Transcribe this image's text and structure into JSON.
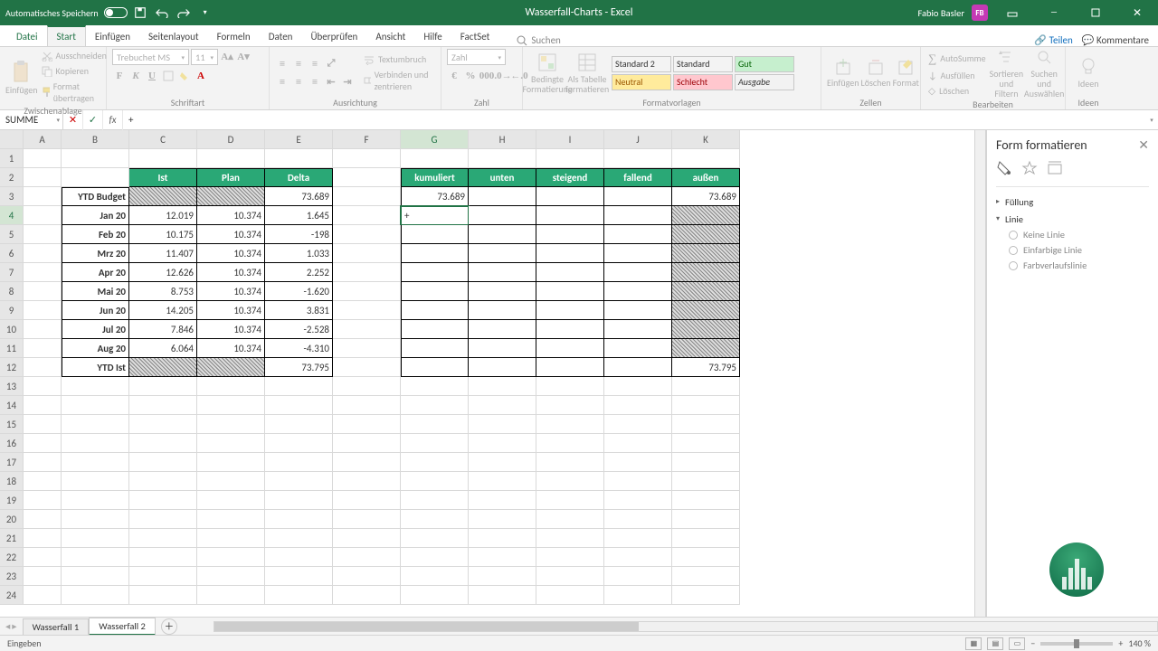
{
  "titlebar": {
    "autosave_label": "Automatisches Speichern",
    "doc_title": "Wasserfall-Charts  -  Excel",
    "user_name": "Fabio Basler",
    "user_initials": "FB"
  },
  "tabs": {
    "file": "Datei",
    "items": [
      "Start",
      "Einfügen",
      "Seitenlayout",
      "Formeln",
      "Daten",
      "Überprüfen",
      "Ansicht",
      "Hilfe",
      "FactSet"
    ],
    "active_index": 0,
    "search_placeholder": "Suchen",
    "share": "Teilen",
    "comments": "Kommentare"
  },
  "ribbon": {
    "clipboard": {
      "label": "Zwischenablage",
      "paste": "Einfügen",
      "cut": "Ausschneiden",
      "copy": "Kopieren",
      "format_painter": "Format übertragen"
    },
    "font": {
      "label": "Schriftart",
      "name": "Trebuchet MS",
      "size": "11"
    },
    "alignment": {
      "label": "Ausrichtung",
      "wrap": "Textumbruch",
      "merge": "Verbinden und zentrieren"
    },
    "number": {
      "label": "Zahl",
      "format": "Zahl"
    },
    "styles": {
      "label": "Formatvorlagen",
      "conditional": "Bedingte Formatierung",
      "as_table": "Als Tabelle formatieren",
      "cells": {
        "standard": "Standard",
        "standard2": "Standard 2",
        "gut": "Gut",
        "neutral": "Neutral",
        "schlecht": "Schlecht",
        "ausgabe": "Ausgabe"
      }
    },
    "cells": {
      "label": "Zellen",
      "insert": "Einfügen",
      "delete": "Löschen",
      "format": "Format"
    },
    "editing": {
      "label": "Bearbeiten",
      "autosum": "AutoSumme",
      "fill": "Ausfüllen",
      "clear": "Löschen",
      "sort": "Sortieren und Filtern",
      "find": "Suchen und Auswählen"
    },
    "ideas": {
      "label": "Ideen",
      "btn": "Ideen"
    }
  },
  "namebox": "SUMME",
  "formula": "+",
  "columns": [
    "A",
    "B",
    "C",
    "D",
    "E",
    "F",
    "G",
    "H",
    "I",
    "J",
    "K"
  ],
  "rows_visible": 24,
  "active_col_index": 6,
  "active_row": 4,
  "editing_cell_value": "+",
  "table1": {
    "headers": {
      "ist": "Ist",
      "plan": "Plan",
      "delta": "Delta"
    },
    "rows": [
      {
        "label": "YTD Budget",
        "ist": "",
        "plan": "",
        "delta": "73.689",
        "hatch_ist": true,
        "hatch_plan": true
      },
      {
        "label": "Jan 20",
        "ist": "12.019",
        "plan": "10.374",
        "delta": "1.645"
      },
      {
        "label": "Feb 20",
        "ist": "10.175",
        "plan": "10.374",
        "delta": "-198"
      },
      {
        "label": "Mrz 20",
        "ist": "11.407",
        "plan": "10.374",
        "delta": "1.033"
      },
      {
        "label": "Apr 20",
        "ist": "12.626",
        "plan": "10.374",
        "delta": "2.252"
      },
      {
        "label": "Mai 20",
        "ist": "8.753",
        "plan": "10.374",
        "delta": "-1.620"
      },
      {
        "label": "Jun 20",
        "ist": "14.205",
        "plan": "10.374",
        "delta": "3.831"
      },
      {
        "label": "Jul 20",
        "ist": "7.846",
        "plan": "10.374",
        "delta": "-2.528"
      },
      {
        "label": "Aug 20",
        "ist": "6.064",
        "plan": "10.374",
        "delta": "-4.310"
      },
      {
        "label": "YTD Ist",
        "ist": "",
        "plan": "",
        "delta": "73.795",
        "hatch_ist": true,
        "hatch_plan": true
      }
    ]
  },
  "table2": {
    "headers": {
      "kum": "kumuliert",
      "unten": "unten",
      "steig": "steigend",
      "fall": "fallend",
      "aussen": "außen"
    },
    "rows": [
      {
        "kum": "73.689",
        "aussen": "73.689"
      },
      {
        "kum": "",
        "aussen": "",
        "hatch_aussen": true
      },
      {
        "kum": "",
        "aussen": "",
        "hatch_aussen": true
      },
      {
        "kum": "",
        "aussen": "",
        "hatch_aussen": true
      },
      {
        "kum": "",
        "aussen": "",
        "hatch_aussen": true
      },
      {
        "kum": "",
        "aussen": "",
        "hatch_aussen": true
      },
      {
        "kum": "",
        "aussen": "",
        "hatch_aussen": true
      },
      {
        "kum": "",
        "aussen": "",
        "hatch_aussen": true
      },
      {
        "kum": "",
        "aussen": "",
        "hatch_aussen": true
      },
      {
        "kum": "",
        "aussen": "73.795"
      }
    ]
  },
  "taskpane": {
    "title": "Form formatieren",
    "sect_fill": "Füllung",
    "sect_line": "Linie",
    "line_opts": [
      "Keine Linie",
      "Einfarbige Linie",
      "Farbverlaufslinie"
    ]
  },
  "sheettabs": {
    "items": [
      "Wasserfall 1",
      "Wasserfall 2"
    ],
    "active_index": 1
  },
  "statusbar": {
    "mode": "Eingeben",
    "zoom": "140 %"
  }
}
